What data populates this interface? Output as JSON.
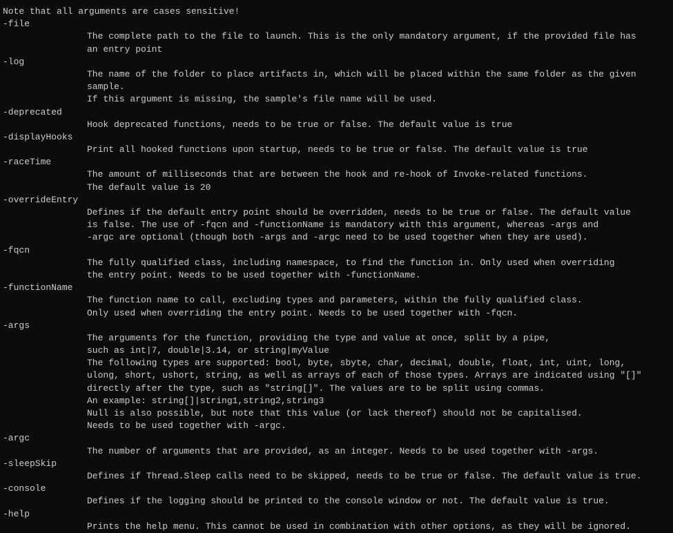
{
  "intro": "Note that all arguments are cases sensitive!",
  "args": {
    "file": {
      "name": "-file",
      "desc": "The complete path to the file to launch. This is the only mandatory argument, if the provided file has\nan entry point"
    },
    "log": {
      "name": "-log",
      "desc": "The name of the folder to place artifacts in, which will be placed within the same folder as the given sample.\nIf this argument is missing, the sample's file name will be used."
    },
    "deprecated": {
      "name": "-deprecated",
      "desc": "Hook deprecated functions, needs to be true or false. The default value is true"
    },
    "displayHooks": {
      "name": "-displayHooks",
      "desc": "Print all hooked functions upon startup, needs to be true or false. The default value is true"
    },
    "raceTime": {
      "name": "-raceTime",
      "desc": "The amount of milliseconds that are between the hook and re-hook of Invoke-related functions.\nThe default value is 20"
    },
    "overrideEntry": {
      "name": "-overrideEntry",
      "desc": "Defines if the default entry point should be overridden, needs to be true or false. The default value\nis false. The use of -fqcn and -functionName is mandatory with this argument, whereas -args and\n-argc are optional (though both -args and -argc need to be used together when they are used)."
    },
    "fqcn": {
      "name": "-fqcn",
      "desc": "The fully qualified class, including namespace, to find the function in. Only used when overriding\nthe entry point. Needs to be used together with -functionName."
    },
    "functionName": {
      "name": "-functionName",
      "desc": "The function name to call, excluding types and parameters, within the fully qualified class.\nOnly used when overriding the entry point. Needs to be used together with -fqcn."
    },
    "argsParam": {
      "name": "-args",
      "desc": "The arguments for the function, providing the type and value at once, split by a pipe,\nsuch as int|7, double|3.14, or string|myValue\nThe following types are supported: bool, byte, sbyte, char, decimal, double, float, int, uint, long,\nulong, short, ushort, string, as well as arrays of each of those types. Arrays are indicated using \"[]\"\ndirectly after the type, such as \"string[]\". The values are to be split using commas.\nAn example: string[]|string1,string2,string3\nNull is also possible, but note that this value (or lack thereof) should not be capitalised.\nNeeds to be used together with -argc."
    },
    "argc": {
      "name": "-argc",
      "desc": "The number of arguments that are provided, as an integer. Needs to be used together with -args."
    },
    "sleepSkip": {
      "name": "-sleepSkip",
      "desc": "Defines if Thread.Sleep calls need to be skipped, needs to be true or false. The default value is true."
    },
    "console": {
      "name": "-console",
      "desc": "Defines if the logging should be printed to the console window or not. The default value is true."
    },
    "help": {
      "name": "-help",
      "desc": "Prints the help menu. This cannot be used in combination with other options, as they will be ignored."
    }
  }
}
